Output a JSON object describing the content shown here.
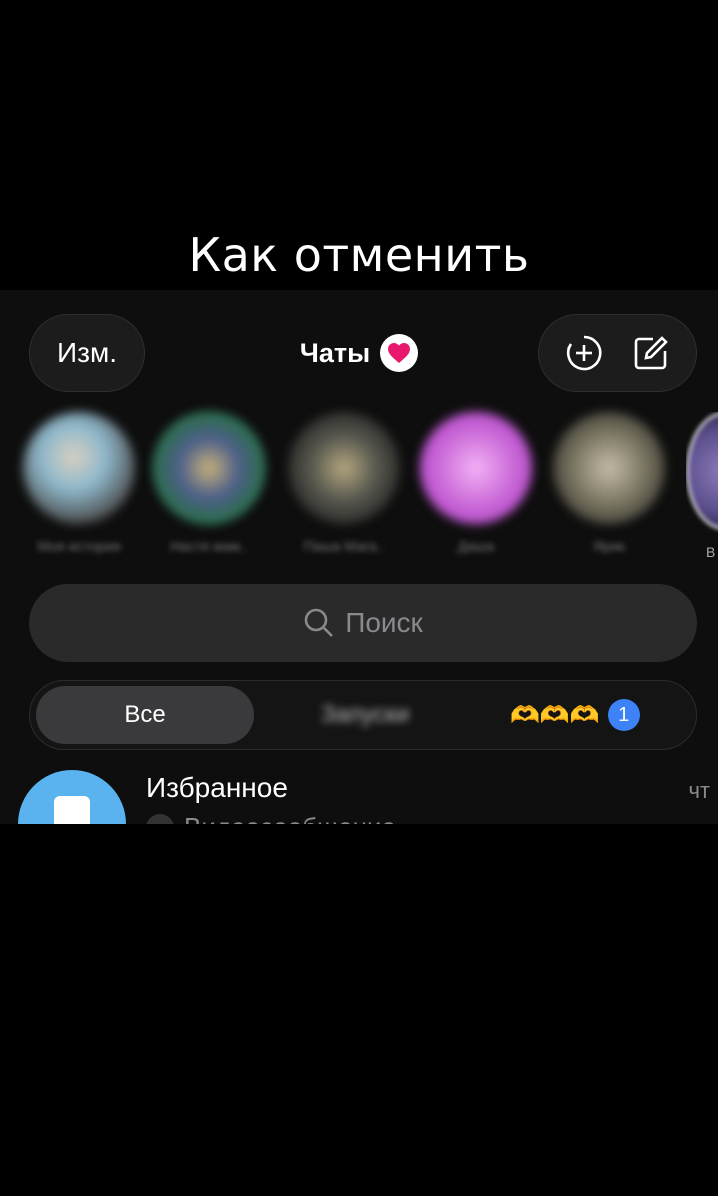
{
  "caption": "Как отменить",
  "header": {
    "edit_label": "Изм.",
    "title": "Чаты",
    "title_badge_icon": "heart-icon",
    "actions": [
      "add-story-icon",
      "compose-icon"
    ]
  },
  "stories": [
    {
      "label": "Моя история"
    },
    {
      "label": "Настя мам.."
    },
    {
      "label": "Паша Мага.."
    },
    {
      "label": "Даша"
    },
    {
      "label": "Ярик"
    },
    {
      "label": "В"
    }
  ],
  "search": {
    "placeholder": "Поиск"
  },
  "filters": {
    "tabs": [
      "Все",
      "Запуски",
      "🫶🫶🫶"
    ],
    "active": "Все",
    "unread_count": "1"
  },
  "chats": [
    {
      "name": "Избранное",
      "time": "чт",
      "preview": "Видеосообщение"
    }
  ],
  "colors": {
    "accent_blue": "#3d82f6",
    "heart_pink": "#e8186d",
    "saved_avatar": "#5ab3ee"
  }
}
